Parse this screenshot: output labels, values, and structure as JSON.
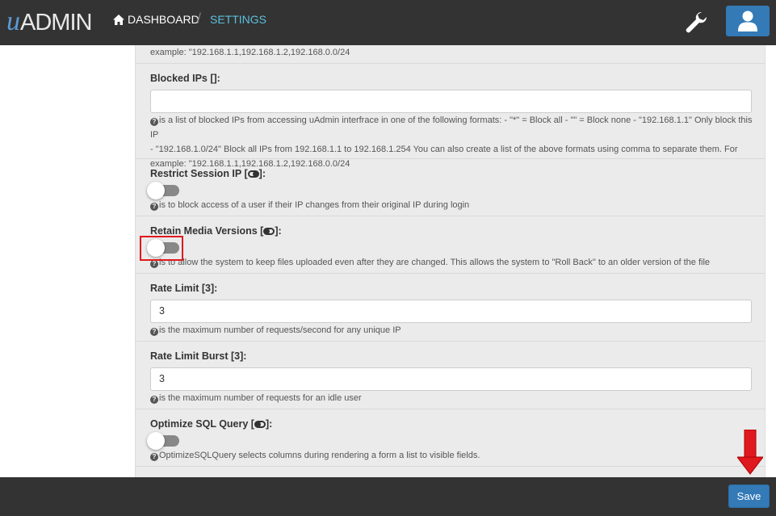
{
  "header": {
    "logo_u": "u",
    "logo_admin": "ADMIN",
    "nav_dashboard": "DASHBOARD",
    "nav_separator": "/",
    "nav_settings": "SETTINGS",
    "wrench_icon": "wrench-icon",
    "user_icon": "user-icon"
  },
  "help_top": "example: \"192.168.1.1,192.168.1.2,192.168.0.0/24",
  "fields": {
    "blocked_ips": {
      "label": "Blocked IPs []:",
      "value": "",
      "help_line1": "is a list of blocked IPs from accessing uAdmin interfrace in one of the following formats: - \"*\" = Block all - \"\" = Block none - \"192.168.1.1\" Only block this IP",
      "help_line2": "- \"192.168.1.0/24\" Block all IPs from 192.168.1.1 to 192.168.1.254 You can also create a list of the above formats using comma to separate them. For",
      "help_line3": "example: \"192.168.1.1,192.168.1.2,192.168.0.0/24"
    },
    "restrict_session_ip": {
      "label_pre": "Restrict Session IP [",
      "label_post": "]:",
      "checked": false,
      "help": "is to block access of a user if their IP changes from their original IP during login"
    },
    "retain_media_versions": {
      "label_pre": "Retain Media Versions [",
      "label_post": "]:",
      "checked": false,
      "help": "is to allow the system to keep files uploaded even after they are changed. This allows the system to \"Roll Back\" to an older version of the file"
    },
    "rate_limit": {
      "label": "Rate Limit [3]:",
      "value": "3",
      "help": "is the maximum number of requests/second for any unique IP"
    },
    "rate_limit_burst": {
      "label": "Rate Limit Burst [3]:",
      "value": "3",
      "help": "is the maximum number of requests for an idle user"
    },
    "optimize_sql_query": {
      "label_pre": "Optimize SQL Query [",
      "label_post": "]:",
      "checked": false,
      "help": "OptimizeSQLQuery selects columns during rendering a form a list to visible fields."
    }
  },
  "footer": {
    "save_label": "Save"
  },
  "colors": {
    "navbar": "#333333",
    "accent": "#337ab7",
    "nav_active": "#5bc0de",
    "highlight": "#e0191e",
    "panel": "#ebebeb"
  }
}
